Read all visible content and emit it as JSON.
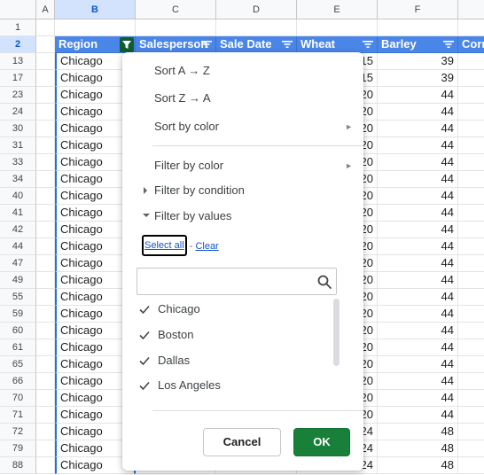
{
  "columns": [
    "A",
    "B",
    "C",
    "D",
    "E",
    "F"
  ],
  "header_row": {
    "row_number": "2",
    "cells": [
      "Region",
      "Salesperson",
      "Sale Date",
      "Wheat",
      "Barley",
      "Corn"
    ]
  },
  "top_row_number": "1",
  "rows": [
    {
      "n": "13",
      "region": "Chicago",
      "wheat": "15",
      "barley": "39"
    },
    {
      "n": "17",
      "region": "Chicago",
      "wheat": "15",
      "barley": "39"
    },
    {
      "n": "23",
      "region": "Chicago",
      "wheat": "20",
      "barley": "44"
    },
    {
      "n": "24",
      "region": "Chicago",
      "wheat": "20",
      "barley": "44"
    },
    {
      "n": "30",
      "region": "Chicago",
      "wheat": "20",
      "barley": "44"
    },
    {
      "n": "31",
      "region": "Chicago",
      "wheat": "20",
      "barley": "44"
    },
    {
      "n": "33",
      "region": "Chicago",
      "wheat": "20",
      "barley": "44"
    },
    {
      "n": "34",
      "region": "Chicago",
      "wheat": "20",
      "barley": "44"
    },
    {
      "n": "40",
      "region": "Chicago",
      "wheat": "20",
      "barley": "44"
    },
    {
      "n": "41",
      "region": "Chicago",
      "wheat": "20",
      "barley": "44"
    },
    {
      "n": "42",
      "region": "Chicago",
      "wheat": "20",
      "barley": "44"
    },
    {
      "n": "44",
      "region": "Chicago",
      "wheat": "20",
      "barley": "44"
    },
    {
      "n": "47",
      "region": "Chicago",
      "wheat": "20",
      "barley": "44"
    },
    {
      "n": "49",
      "region": "Chicago",
      "wheat": "20",
      "barley": "44"
    },
    {
      "n": "55",
      "region": "Chicago",
      "wheat": "20",
      "barley": "44"
    },
    {
      "n": "59",
      "region": "Chicago",
      "wheat": "20",
      "barley": "44"
    },
    {
      "n": "60",
      "region": "Chicago",
      "wheat": "20",
      "barley": "44"
    },
    {
      "n": "61",
      "region": "Chicago",
      "wheat": "20",
      "barley": "44"
    },
    {
      "n": "65",
      "region": "Chicago",
      "wheat": "20",
      "barley": "44"
    },
    {
      "n": "66",
      "region": "Chicago",
      "wheat": "20",
      "barley": "44"
    },
    {
      "n": "70",
      "region": "Chicago",
      "wheat": "20",
      "barley": "44"
    },
    {
      "n": "71",
      "region": "Chicago",
      "wheat": "20",
      "barley": "44"
    },
    {
      "n": "72",
      "region": "Chicago",
      "wheat": "24",
      "barley": "48"
    },
    {
      "n": "79",
      "region": "Chicago",
      "wheat": "24",
      "barley": "48"
    },
    {
      "n": "88",
      "region": "Chicago",
      "wheat": "24",
      "barley": "48"
    }
  ],
  "filter_menu": {
    "sort_az": "Sort A → Z",
    "sort_za": "Sort Z → A",
    "sort_by_color": "Sort by color",
    "filter_by_color": "Filter by color",
    "filter_by_condition": "Filter by condition",
    "filter_by_values": "Filter by values",
    "select_all": "Select all",
    "separator": "-",
    "clear": "Clear",
    "search_placeholder": "",
    "values": [
      "Chicago",
      "Boston",
      "Dallas",
      "Los Angeles"
    ],
    "cancel": "Cancel",
    "ok": "OK"
  },
  "colors": {
    "header_fill": "#4a86e8",
    "active_filter": "#0e5e33",
    "ok_button": "#188038",
    "link": "#1155cc"
  },
  "icons": [
    "filter-icon",
    "active-filter-icon",
    "search-icon",
    "check-icon",
    "triangle-right-icon",
    "triangle-down-icon",
    "submenu-arrow-icon"
  ]
}
